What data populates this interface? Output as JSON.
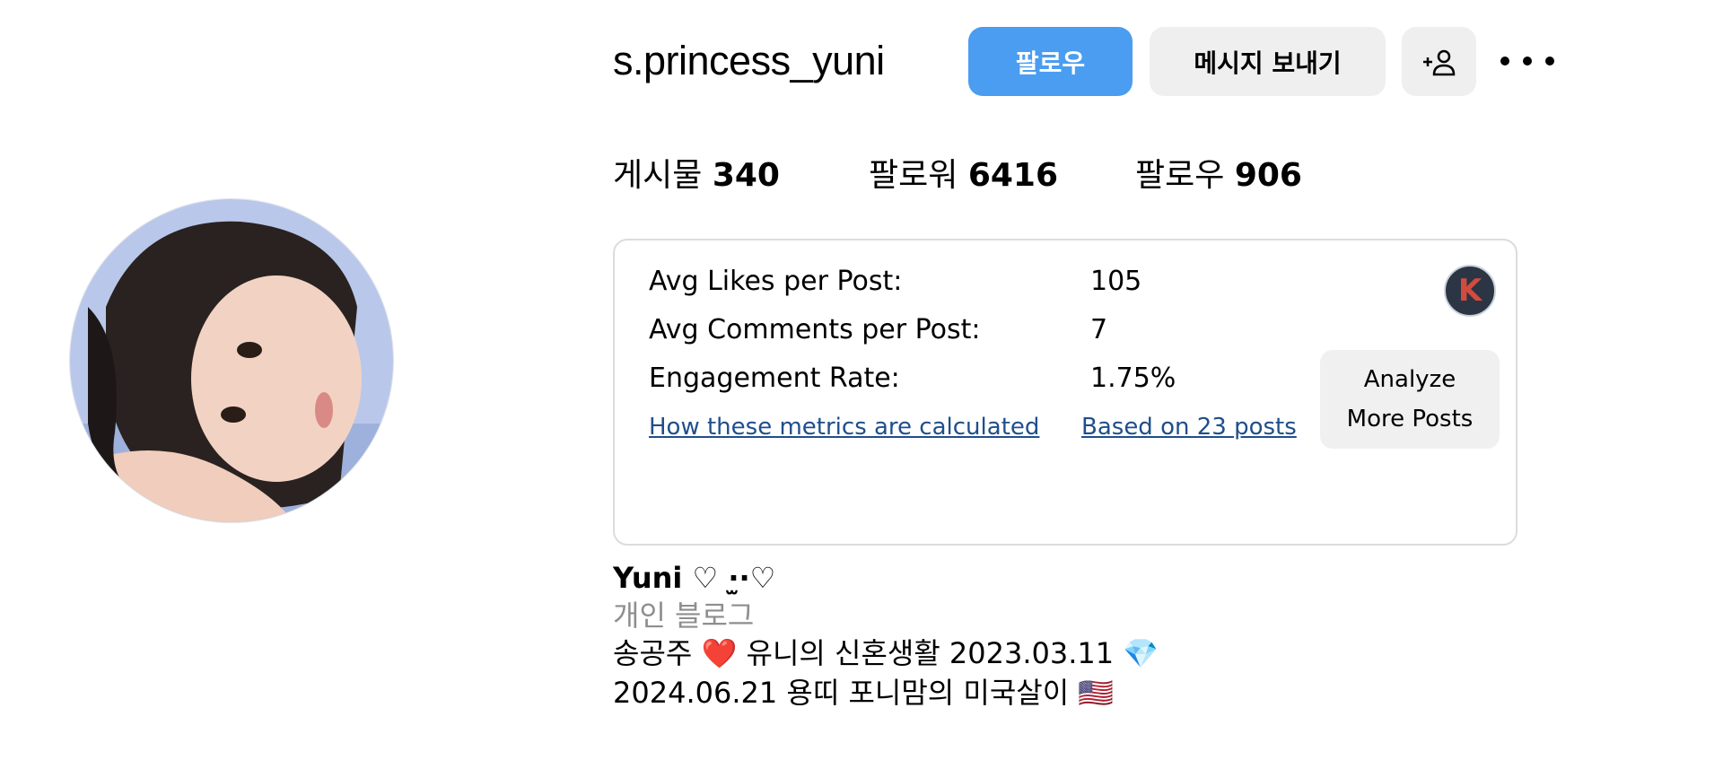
{
  "profile": {
    "username": "s.princess_yuni",
    "avatar": "profile-photo"
  },
  "actions": {
    "follow_label": "팔로우",
    "message_label": "메시지 보내기",
    "add_user_icon": "person-plus-icon",
    "more_icon": "more-horizontal-icon"
  },
  "stats": {
    "posts_label": "게시물",
    "posts_count": "340",
    "followers_label": "팔로워",
    "followers_count": "6416",
    "following_label": "팔로우",
    "following_count": "906"
  },
  "metrics": {
    "rows": [
      {
        "label": "Avg Likes per Post:",
        "value": "105"
      },
      {
        "label": "Avg Comments per Post:",
        "value": "7"
      },
      {
        "label": "Engagement Rate:",
        "value": "1.75%"
      }
    ],
    "how_link": "How these metrics are calculated",
    "based_on_link": "Based on 23 posts",
    "badge_letter": "K",
    "analyze_label_line1": "Analyze",
    "analyze_label_line2": "More Posts"
  },
  "bio": {
    "name": "Yuni ♡ ·̫·♡",
    "category": "개인 블로그",
    "line1": "송공주 ❤️ 유니의 신혼생활 2023.03.11 💎",
    "line2": "2024.06.21 용띠 포니맘의 미국살이 🇺🇸"
  },
  "colors": {
    "follow_button": "#4a9df0",
    "secondary_button": "#efefef",
    "link": "#1f4e8c",
    "muted_text": "#8e8e8e",
    "card_border": "#dcdcdc"
  }
}
